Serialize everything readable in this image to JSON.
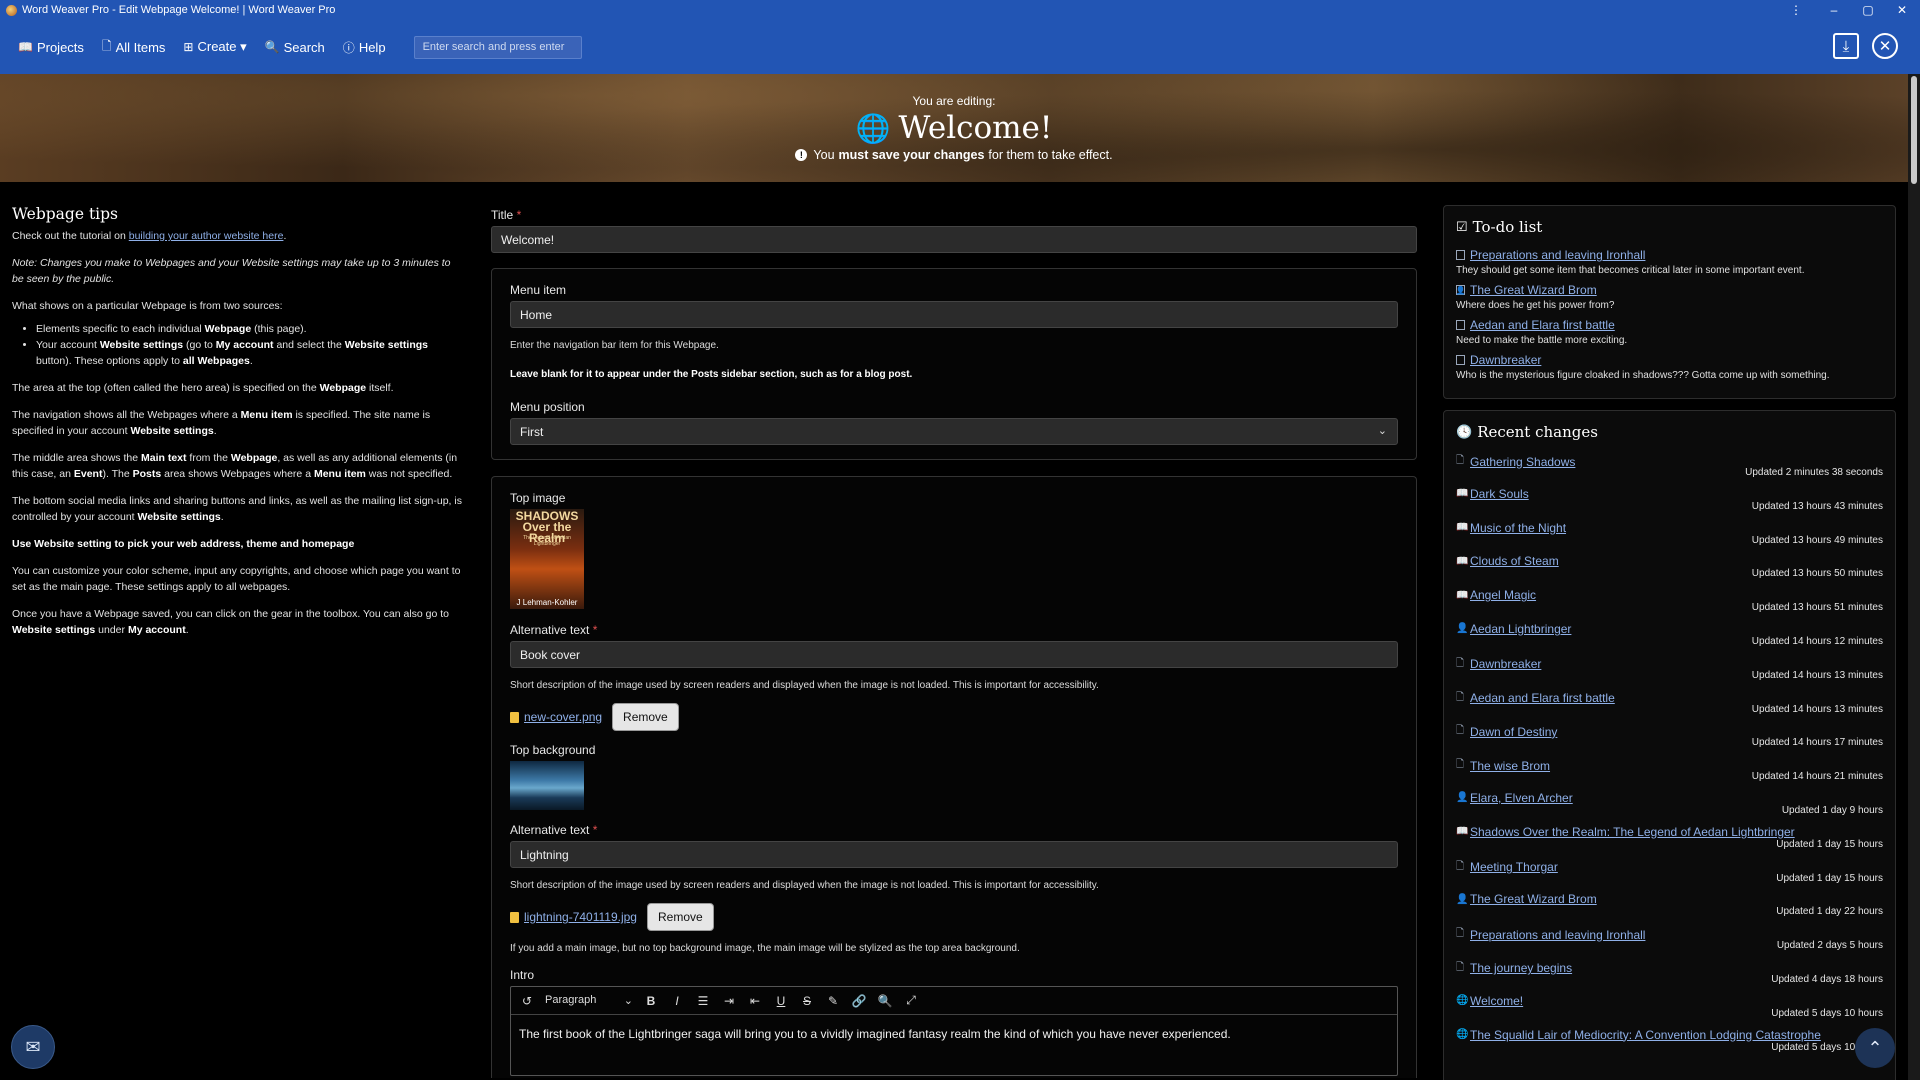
{
  "window": {
    "title": "Word Weaver Pro - Edit Webpage Welcome! | Word Weaver Pro",
    "controls": [
      "⋮",
      "–",
      "▢",
      "✕"
    ]
  },
  "nav": {
    "items": [
      {
        "icon": "book-icon",
        "glyph": "📖",
        "label": "Projects"
      },
      {
        "icon": "file-icon",
        "glyph": "🗋",
        "label": "All Items"
      },
      {
        "icon": "plus-square-icon",
        "glyph": "⊞",
        "label": "Create ▾"
      },
      {
        "icon": "search-icon",
        "glyph": "🔍",
        "label": "Search"
      },
      {
        "icon": "help-icon",
        "glyph": "ⓘ",
        "label": "Help"
      }
    ],
    "search_placeholder": "Enter search and press enter",
    "save_glyph": "⤓",
    "close_glyph": "✕"
  },
  "hero": {
    "editing_label": "You are editing:",
    "title": "Welcome!",
    "note_pre": "You",
    "note_bold": "must save your changes",
    "note_post": "for them to take effect."
  },
  "tips": {
    "heading": "Webpage tips",
    "tutorial_pre": "Check out the tutorial on ",
    "tutorial_link": "building your author website here",
    "tutorial_post": ".",
    "note": "Note: Changes you make to Webpages and your Website settings may take up to 3 minutes to be seen by the public.",
    "sources_intro": "What shows on a particular Webpage is from two sources:",
    "bullet1_pre": "Elements specific to each individual ",
    "bullet1_b": "Webpage",
    "bullet1_post": " (this page).",
    "bullet2_a": "Your account ",
    "bullet2_b": "Website settings",
    "bullet2_c": " (go to ",
    "bullet2_d": "My account",
    "bullet2_e": " and select the ",
    "bullet2_f": "Website settings",
    "bullet2_g": " button). These options apply to ",
    "bullet2_h": "all Webpages",
    "bullet2_i": ".",
    "p_hero_pre": "The area at the top (often called the hero area) is specified on the ",
    "p_hero_b": "Webpage",
    "p_hero_post": " itself.",
    "p_nav_a": "The navigation shows all the Webpages where a ",
    "p_nav_b": "Menu item",
    "p_nav_c": " is specified. The site name is specified in your account ",
    "p_nav_d": "Website settings",
    "p_nav_e": ".",
    "p_mid_a": "The middle area shows the ",
    "p_mid_b": "Main text",
    "p_mid_c": " from the ",
    "p_mid_d": "Webpage",
    "p_mid_e": ", as well as any additional elements (in this case, an ",
    "p_mid_f": "Event",
    "p_mid_g": "). The ",
    "p_mid_h": "Posts",
    "p_mid_i": " area shows Webpages where a ",
    "p_mid_j": "Menu item",
    "p_mid_k": " was not specified.",
    "p_bottom_a": "The bottom social media links and sharing buttons and links, as well as the mailing list sign-up, is controlled by your account ",
    "p_bottom_b": "Website settings",
    "p_bottom_c": ".",
    "p_use": "Use Website setting to pick your web address, theme and homepage",
    "p_custom": "You can customize your color scheme, input any copyrights, and choose which page you want to set as the main page. These settings apply to all webpages.",
    "p_gear_a": "Once you have a Webpage saved, you can click on the gear in the toolbox. You can also go to ",
    "p_gear_b": "Website settings",
    "p_gear_c": " under ",
    "p_gear_d": "My account",
    "p_gear_e": "."
  },
  "form": {
    "title_label": "Title",
    "title_value": "Welcome!",
    "menu_item_label": "Menu item",
    "menu_item_value": "Home",
    "menu_item_help": "Enter the navigation bar item for this Webpage.",
    "menu_item_help_bold": "Leave blank for it to appear under the Posts sidebar section, such as for a blog post.",
    "menu_position_label": "Menu position",
    "menu_position_value": "First",
    "top_image_label": "Top image",
    "cover_title": "SHADOWS Over the Realm",
    "cover_subtitle": "The Legend of Aedan Lightbringer",
    "cover_author": "J Lehman-Kohler",
    "alt_label": "Alternative text",
    "top_image_alt": "Book cover",
    "alt_help": "Short description of the image used by screen readers and displayed when the image is not loaded. This is important for accessibility.",
    "top_image_file": "new-cover.png",
    "remove_label": "Remove",
    "top_bg_label": "Top background",
    "top_bg_alt": "Lightning",
    "top_bg_file": "lightning-7401119.jpg",
    "bg_help": "If you add a main image, but no top background image, the main image will be stylized as the top area background.",
    "intro_label": "Intro",
    "paragraph_label": "Paragraph",
    "intro_text": "The first book of the Lightbringer saga will bring you to a vividly imagined fantasy realm the kind of which you have never experienced."
  },
  "todo": {
    "heading": "To-do list",
    "items": [
      {
        "icon": "file-icon",
        "glyph": "",
        "title": "Preparations and leaving Ironhall",
        "desc": "They should get some item that becomes critical later in some important event."
      },
      {
        "icon": "person-icon",
        "glyph": "👤",
        "title": "The Great Wizard Brom",
        "desc": "Where does he get his power from?"
      },
      {
        "icon": "file-icon",
        "glyph": "",
        "title": "Aedan and Elara first battle",
        "desc": "Need to make the battle more exciting."
      },
      {
        "icon": "file-icon",
        "glyph": "",
        "title": "Dawnbreaker",
        "desc": "Who is the mysterious figure cloaked in shadows??? Gotta come up with something."
      }
    ]
  },
  "recent": {
    "heading": "Recent changes",
    "items": [
      {
        "icon": "file-icon",
        "glyph": "🗋",
        "title": "Gathering Shadows",
        "time": "Updated 2 minutes 38 seconds"
      },
      {
        "icon": "book-icon",
        "glyph": "📖",
        "title": "Dark Souls",
        "time": "Updated 13 hours 43 minutes"
      },
      {
        "icon": "book-icon",
        "glyph": "📖",
        "title": "Music of the Night",
        "time": "Updated 13 hours 49 minutes"
      },
      {
        "icon": "book-icon",
        "glyph": "📖",
        "title": "Clouds of Steam",
        "time": "Updated 13 hours 50 minutes"
      },
      {
        "icon": "book-icon",
        "glyph": "📖",
        "title": "Angel Magic",
        "time": "Updated 13 hours 51 minutes"
      },
      {
        "icon": "person-icon",
        "glyph": "👤",
        "title": "Aedan Lightbringer",
        "time": "Updated 14 hours 12 minutes"
      },
      {
        "icon": "file-icon",
        "glyph": "🗋",
        "title": "Dawnbreaker",
        "time": "Updated 14 hours 13 minutes"
      },
      {
        "icon": "file-icon",
        "glyph": "🗋",
        "title": "Aedan and Elara first battle",
        "time": "Updated 14 hours 13 minutes"
      },
      {
        "icon": "file-icon",
        "glyph": "🗋",
        "title": "Dawn of Destiny",
        "time": "Updated 14 hours 17 minutes"
      },
      {
        "icon": "file-icon",
        "glyph": "🗋",
        "title": "The wise Brom",
        "time": "Updated 14 hours 21 minutes"
      },
      {
        "icon": "person-icon",
        "glyph": "👤",
        "title": "Elara, Elven Archer",
        "time": "Updated 1 day 9 hours"
      },
      {
        "icon": "book-icon",
        "glyph": "📖",
        "title": "Shadows Over the Realm: The Legend of Aedan Lightbringer",
        "time": "Updated 1 day 15 hours"
      },
      {
        "icon": "file-icon",
        "glyph": "🗋",
        "title": "Meeting Thorgar",
        "time": "Updated 1 day 15 hours"
      },
      {
        "icon": "person-icon",
        "glyph": "👤",
        "title": "The Great Wizard Brom",
        "time": "Updated 1 day 22 hours"
      },
      {
        "icon": "file-icon",
        "glyph": "🗋",
        "title": "Preparations and leaving Ironhall",
        "time": "Updated 2 days 5 hours"
      },
      {
        "icon": "file-icon",
        "glyph": "🗋",
        "title": "The journey begins",
        "time": "Updated 4 days 18 hours"
      },
      {
        "icon": "globe-icon",
        "glyph": "🌐",
        "title": "Welcome!",
        "time": "Updated 5 days 10 hours"
      },
      {
        "icon": "globe-icon",
        "glyph": "🌐",
        "title": "The Squalid Lair of Mediocrity: A Convention Lodging Catastrophe",
        "time": "Updated 5 days 10 hours"
      }
    ]
  }
}
